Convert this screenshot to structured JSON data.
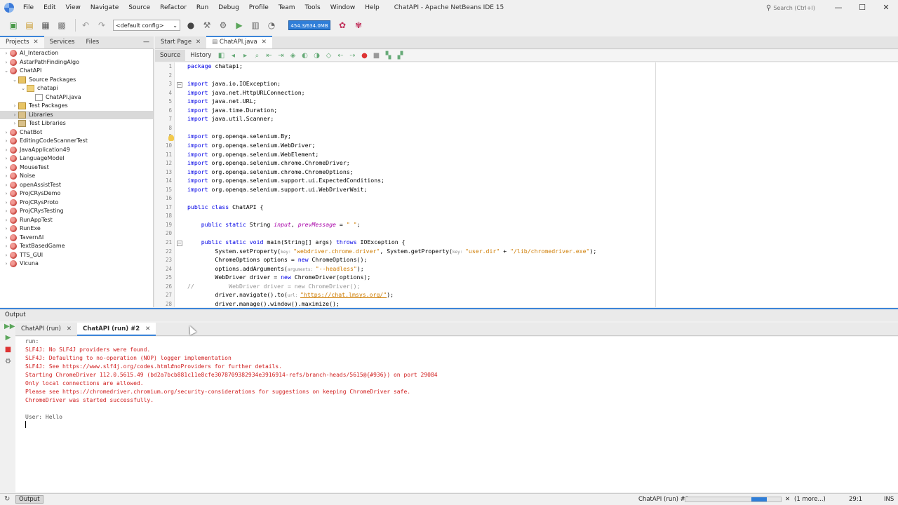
{
  "window": {
    "title": "ChatAPI - Apache NetBeans IDE 15",
    "search_placeholder": "Search (Ctrl+I)",
    "menu": [
      "File",
      "Edit",
      "View",
      "Navigate",
      "Source",
      "Refactor",
      "Run",
      "Debug",
      "Profile",
      "Team",
      "Tools",
      "Window",
      "Help"
    ]
  },
  "toolbar": {
    "config": "<default config>",
    "memory": "454.3/634.0MB"
  },
  "left_panel": {
    "tabs": [
      "Projects",
      "Services",
      "Files"
    ],
    "tree": [
      {
        "label": "AI_Interaction",
        "depth": 0,
        "icon": "proj",
        "arrow": "›"
      },
      {
        "label": "AstarPathFindingAlgo",
        "depth": 0,
        "icon": "proj",
        "arrow": "›"
      },
      {
        "label": "ChatAPI",
        "depth": 0,
        "icon": "proj",
        "arrow": "⌄"
      },
      {
        "label": "Source Packages",
        "depth": 1,
        "icon": "pkg",
        "arrow": "⌄"
      },
      {
        "label": "chatapi",
        "depth": 2,
        "icon": "folder",
        "arrow": "⌄"
      },
      {
        "label": "ChatAPI.java",
        "depth": 3,
        "icon": "file",
        "arrow": ""
      },
      {
        "label": "Test Packages",
        "depth": 1,
        "icon": "pkg",
        "arrow": "›"
      },
      {
        "label": "Libraries",
        "depth": 1,
        "icon": "lib",
        "arrow": "›",
        "selected": true
      },
      {
        "label": "Test Libraries",
        "depth": 1,
        "icon": "lib",
        "arrow": "›"
      },
      {
        "label": "ChatBot",
        "depth": 0,
        "icon": "proj",
        "arrow": "›"
      },
      {
        "label": "EditingCodeScannerTest",
        "depth": 0,
        "icon": "proj",
        "arrow": "›"
      },
      {
        "label": "JavaApplication49",
        "depth": 0,
        "icon": "proj",
        "arrow": "›"
      },
      {
        "label": "LanguageModel",
        "depth": 0,
        "icon": "proj",
        "arrow": "›"
      },
      {
        "label": "MouseTest",
        "depth": 0,
        "icon": "proj",
        "arrow": "›"
      },
      {
        "label": "Noise",
        "depth": 0,
        "icon": "proj",
        "arrow": "›"
      },
      {
        "label": "openAssistTest",
        "depth": 0,
        "icon": "proj",
        "arrow": "›"
      },
      {
        "label": "ProjCRysDemo",
        "depth": 0,
        "icon": "proj",
        "arrow": "›"
      },
      {
        "label": "ProjCRysProto",
        "depth": 0,
        "icon": "proj",
        "arrow": "›"
      },
      {
        "label": "ProjCRysTesting",
        "depth": 0,
        "icon": "proj",
        "arrow": "›"
      },
      {
        "label": "RunAppTest",
        "depth": 0,
        "icon": "proj",
        "arrow": "›"
      },
      {
        "label": "RunExe",
        "depth": 0,
        "icon": "proj",
        "arrow": "›"
      },
      {
        "label": "TavernAI",
        "depth": 0,
        "icon": "proj",
        "arrow": "›"
      },
      {
        "label": "TextBasedGame",
        "depth": 0,
        "icon": "proj",
        "arrow": "›"
      },
      {
        "label": "TTS_GUI",
        "depth": 0,
        "icon": "proj",
        "arrow": "›"
      },
      {
        "label": "Vicuna",
        "depth": 0,
        "icon": "proj",
        "arrow": "›"
      }
    ]
  },
  "editor": {
    "tabs": [
      "Start Page",
      "ChatAPI.java"
    ],
    "views": [
      "Source",
      "History"
    ],
    "lines": [
      [
        [
          "k",
          "package"
        ],
        [
          "",
          "chatapi;"
        ]
      ],
      [],
      [
        [
          "k",
          "import"
        ],
        [
          "",
          "java.io.IOException;"
        ]
      ],
      [
        [
          "k",
          "import"
        ],
        [
          "",
          "java.net.HttpURLConnection;"
        ]
      ],
      [
        [
          "k",
          "import"
        ],
        [
          "",
          "java.net.URL;"
        ]
      ],
      [
        [
          "k",
          "import"
        ],
        [
          "",
          "java.time.Duration;"
        ]
      ],
      [
        [
          "k",
          "import"
        ],
        [
          "",
          "java.util.Scanner;"
        ]
      ],
      [],
      [
        [
          "k",
          "import"
        ],
        [
          "",
          "org.openqa.selenium.By;"
        ]
      ],
      [
        [
          "k",
          "import"
        ],
        [
          "",
          "org.openqa.selenium.WebDriver;"
        ]
      ],
      [
        [
          "k",
          "import"
        ],
        [
          "",
          "org.openqa.selenium.WebElement;"
        ]
      ],
      [
        [
          "k",
          "import"
        ],
        [
          "",
          "org.openqa.selenium.chrome.ChromeDriver;"
        ]
      ],
      [
        [
          "k",
          "import"
        ],
        [
          "",
          "org.openqa.selenium.chrome.ChromeOptions;"
        ]
      ],
      [
        [
          "k",
          "import"
        ],
        [
          "",
          "org.openqa.selenium.support.ui.ExpectedConditions;"
        ]
      ],
      [
        [
          "k",
          "import"
        ],
        [
          "",
          "org.openqa.selenium.support.ui.WebDriverWait;"
        ]
      ],
      [],
      [
        [
          "k",
          "public class"
        ],
        [
          "",
          " ChatAPI {"
        ]
      ],
      [],
      [
        [
          "",
          "    "
        ],
        [
          "k",
          "public static"
        ],
        [
          "",
          " String "
        ],
        [
          "f",
          "input"
        ],
        [
          "",
          ", "
        ],
        [
          "f",
          "prevMessage"
        ],
        [
          "",
          " = "
        ],
        [
          "s",
          "\" \""
        ],
        [
          "",
          ";"
        ]
      ],
      [],
      [
        [
          "",
          "    "
        ],
        [
          "k",
          "public static void"
        ],
        [
          "",
          " main(String[] args) "
        ],
        [
          "k",
          "throws"
        ],
        [
          "",
          " IOException {"
        ]
      ],
      [
        [
          "",
          "        System."
        ],
        [
          "",
          "setProperty("
        ],
        [
          "pn",
          "key: "
        ],
        [
          "s",
          "\"webdriver.chrome.driver\""
        ],
        [
          "",
          ", System.getProperty("
        ],
        [
          "pn",
          "key: "
        ],
        [
          "s",
          "\"user.dir\""
        ],
        [
          "",
          " + "
        ],
        [
          "s",
          "\"/lib/chromedriver.exe\""
        ],
        [
          "",
          ");"
        ]
      ],
      [
        [
          "",
          "        ChromeOptions options = "
        ],
        [
          "k",
          "new"
        ],
        [
          "",
          " ChromeOptions();"
        ]
      ],
      [
        [
          "",
          "        options.addArguments("
        ],
        [
          "pn",
          "arguments: "
        ],
        [
          "s",
          "\"--headless\""
        ],
        [
          "",
          ");"
        ]
      ],
      [
        [
          "",
          "        WebDriver driver = "
        ],
        [
          "k",
          "new"
        ],
        [
          "",
          " ChromeDriver(options);"
        ]
      ],
      [
        [
          "c",
          "//          WebDriver driver = new ChromeDriver();"
        ]
      ],
      [
        [
          "",
          "        driver.navigate().to("
        ],
        [
          "pn",
          "url: "
        ],
        [
          "u",
          "\"https://chat.lmsys.org/\""
        ],
        [
          "",
          ");"
        ]
      ],
      [
        [
          "",
          "        driver.manage().window().maximize();"
        ]
      ]
    ]
  },
  "output": {
    "title": "Output",
    "tabs": [
      "ChatAPI (run)",
      "ChatAPI (run) #2"
    ],
    "lines": [
      {
        "text": "run:",
        "style": "gray"
      },
      {
        "text": "SLF4J: No SLF4J providers were found.",
        "style": "red"
      },
      {
        "text": "SLF4J: Defaulting to no-operation (NOP) logger implementation",
        "style": "red"
      },
      {
        "text": "SLF4J: See https://www.slf4j.org/codes.html#noProviders for further details.",
        "style": "red"
      },
      {
        "text": "Starting ChromeDriver 112.0.5615.49 (bd2a7bcb881c11e8cfe3078709382934e3916914-refs/branch-heads/5615@{#936}) on port 29084",
        "style": "red"
      },
      {
        "text": "Only local connections are allowed.",
        "style": "red"
      },
      {
        "text": "Please see https://chromedriver.chromium.org/security-considerations for suggestions on keeping ChromeDriver safe.",
        "style": "red"
      },
      {
        "text": "ChromeDriver was started successfully.",
        "style": "red"
      },
      {
        "text": "",
        "style": "gray"
      },
      {
        "text": "User: Hello",
        "style": "gray"
      }
    ]
  },
  "status": {
    "output_label": "Output",
    "task": "ChatAPI (run) #2",
    "more": "(1 more...)",
    "position": "29:1",
    "mode": "INS"
  }
}
